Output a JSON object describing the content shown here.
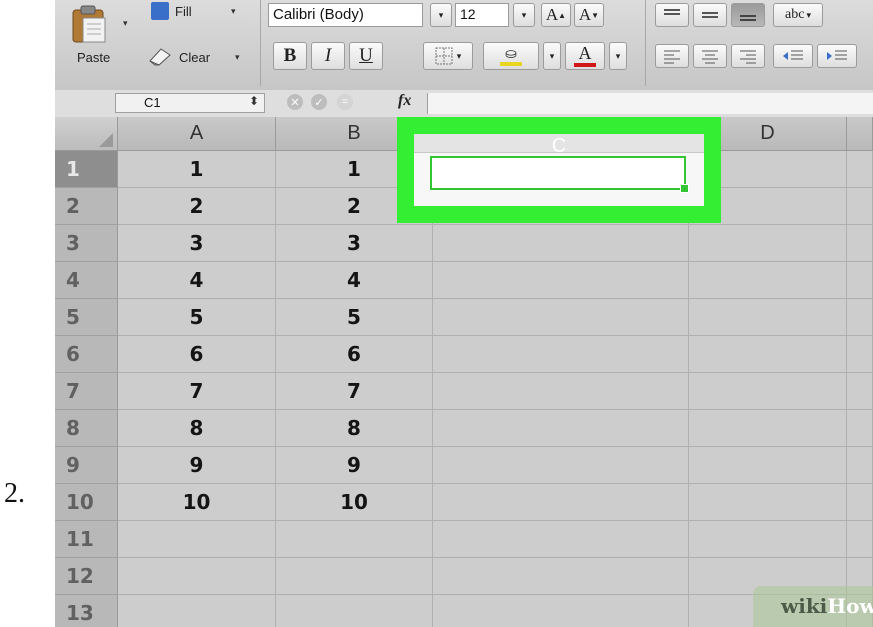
{
  "step_number": "2.",
  "ribbon": {
    "paste_label": "Paste",
    "fill_label": "Fill",
    "clear_label": "Clear",
    "dropdown_glyph": "▾",
    "font_name": "Calibri (Body)",
    "font_size": "12",
    "grow_label": "A",
    "shrink_label": "A",
    "bold_label": "B",
    "italic_label": "I",
    "underline_label": "U",
    "font_color_label": "A",
    "abc_label": "abc",
    "highlight_color": "#e8d623",
    "font_color": "#d01818"
  },
  "formula_bar": {
    "cell_ref": "C1",
    "fx_label": "fx",
    "formula": ""
  },
  "grid": {
    "columns": [
      "A",
      "B",
      "C",
      "D"
    ],
    "rows": [
      "1",
      "2",
      "3",
      "4",
      "5",
      "6",
      "7",
      "8",
      "9",
      "10",
      "11",
      "12",
      "13"
    ],
    "col_a": [
      "1",
      "2",
      "3",
      "4",
      "5",
      "6",
      "7",
      "8",
      "9",
      "10",
      "",
      "",
      ""
    ],
    "col_b": [
      "1",
      "2",
      "3",
      "4",
      "5",
      "6",
      "7",
      "8",
      "9",
      "10",
      "",
      "",
      ""
    ],
    "selected_cell": "C1",
    "highlight_color": "#33ee33"
  },
  "watermark": {
    "wiki": "wiki",
    "how": "How"
  }
}
